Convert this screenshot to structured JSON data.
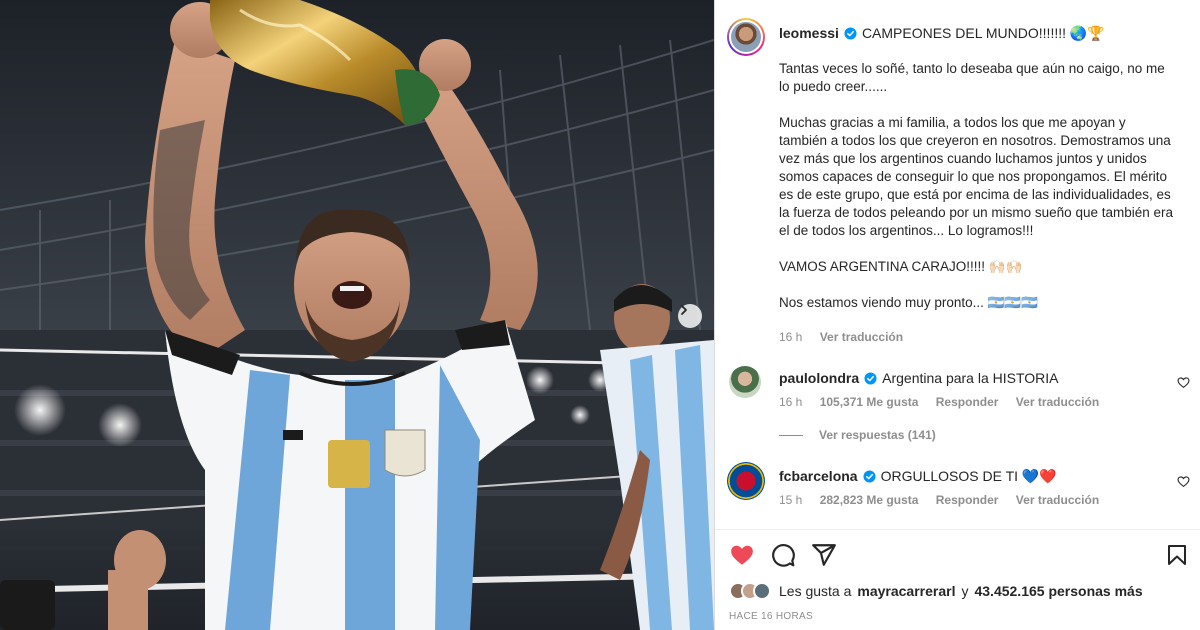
{
  "post": {
    "username": "leomessi",
    "headline": "CAMPEONES DEL MUNDO!!!!!!! 🌏🏆",
    "caption": "Tantas veces lo soñé, tanto lo deseaba que aún no caigo, no me lo puedo creer......\n\nMuchas gracias a mi familia, a todos los que me apoyan y también a todos los que creyeron en nosotros. Demostramos una vez más que los argentinos cuando luchamos juntos y unidos somos capaces de conseguir lo que nos propongamos. El mérito es de este grupo, que está por encima de las individualidades, es la fuerza de todos peleando por un mismo sueño que también era el de todos los argentinos... Lo logramos!!!\n\nVAMOS ARGENTINA CARAJO!!!!! 🙌🏻🙌🏻\n\nNos estamos viendo muy pronto... 🇦🇷🇦🇷🇦🇷",
    "time": "16 h",
    "translate": "Ver traducción"
  },
  "comments": [
    {
      "username": "paulolondra",
      "text": "Argentina para la HISTORIA",
      "time": "16 h",
      "likes": "105,371 Me gusta",
      "reply": "Responder",
      "translate": "Ver traducción",
      "replies": "Ver respuestas (141)"
    },
    {
      "username": "fcbarcelona",
      "text": "ORGULLOSOS DE TI 💙❤️",
      "time": "15 h",
      "likes": "282,823 Me gusta",
      "reply": "Responder",
      "translate": "Ver traducción"
    }
  ],
  "footer": {
    "likes_prefix": "Les gusta a",
    "liked_by": "mayracarrerarl",
    "likes_connector": "y",
    "likes_count": "43.452.165 personas más",
    "time_ago": "HACE 16 HORAS"
  },
  "icons": {
    "liked": "heart-filled-icon",
    "comment": "comment-icon",
    "share": "share-icon",
    "save": "bookmark-icon",
    "next": "chevron-right-icon"
  },
  "colors": {
    "like_red": "#ed4956",
    "verified_blue": "#0095f6",
    "muted": "#8e8e8e",
    "text": "#262626"
  }
}
